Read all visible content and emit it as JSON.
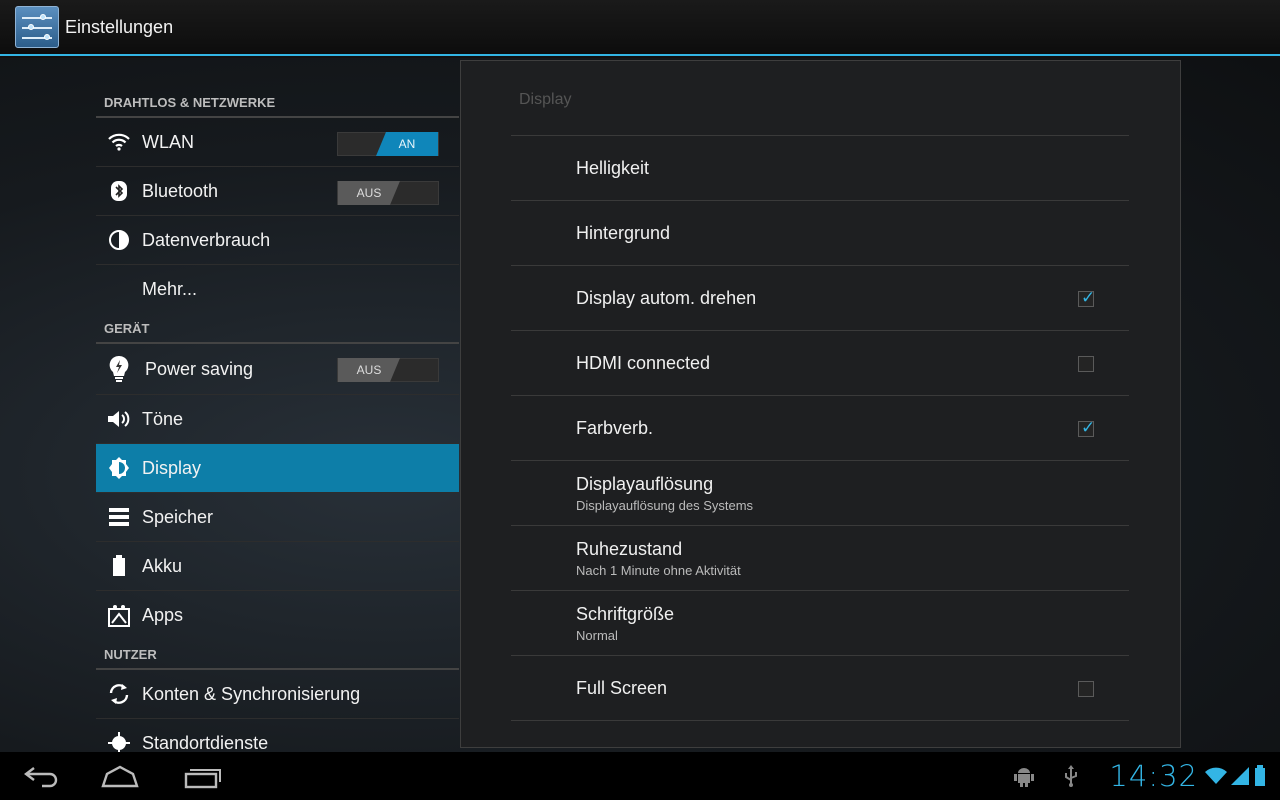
{
  "app": {
    "title": "Einstellungen"
  },
  "left": {
    "sections": [
      {
        "header": "DRAHTLOS & NETZWERKE",
        "items": [
          {
            "label": "WLAN",
            "icon": "wifi-icon",
            "switch": "AN"
          },
          {
            "label": "Bluetooth",
            "icon": "bluetooth-icon",
            "switch": "AUS"
          },
          {
            "label": "Datenverbrauch",
            "icon": "data-usage-icon"
          },
          {
            "label": "Mehr...",
            "icon": ""
          }
        ]
      },
      {
        "header": "GERÄT",
        "items": [
          {
            "label": "Power saving",
            "icon": "lightbulb-icon",
            "switch": "AUS"
          },
          {
            "label": "Töne",
            "icon": "speaker-icon"
          },
          {
            "label": "Display",
            "icon": "brightness-icon",
            "selected": true
          },
          {
            "label": "Speicher",
            "icon": "storage-icon"
          },
          {
            "label": "Akku",
            "icon": "battery-icon"
          },
          {
            "label": "Apps",
            "icon": "apps-icon"
          }
        ]
      },
      {
        "header": "NUTZER",
        "items": [
          {
            "label": "Konten & Synchronisierung",
            "icon": "sync-icon"
          },
          {
            "label": "Standortdienste",
            "icon": "location-icon"
          }
        ]
      }
    ]
  },
  "right": {
    "title": "Display",
    "prefs": [
      {
        "title": "Helligkeit"
      },
      {
        "title": "Hintergrund"
      },
      {
        "title": "Display autom. drehen",
        "checkbox": true
      },
      {
        "title": "HDMI connected",
        "checkbox": false
      },
      {
        "title": "Farbverb.",
        "checkbox": true
      },
      {
        "title": "Displayauflösung",
        "summary": "Displayauflösung des Systems"
      },
      {
        "title": "Ruhezustand",
        "summary": "Nach 1 Minute ohne Aktivität"
      },
      {
        "title": "Schriftgröße",
        "summary": "Normal"
      },
      {
        "title": "Full Screen",
        "checkbox": false
      }
    ]
  },
  "systembar": {
    "clock": "14:32",
    "accent": "#33b5e5"
  }
}
